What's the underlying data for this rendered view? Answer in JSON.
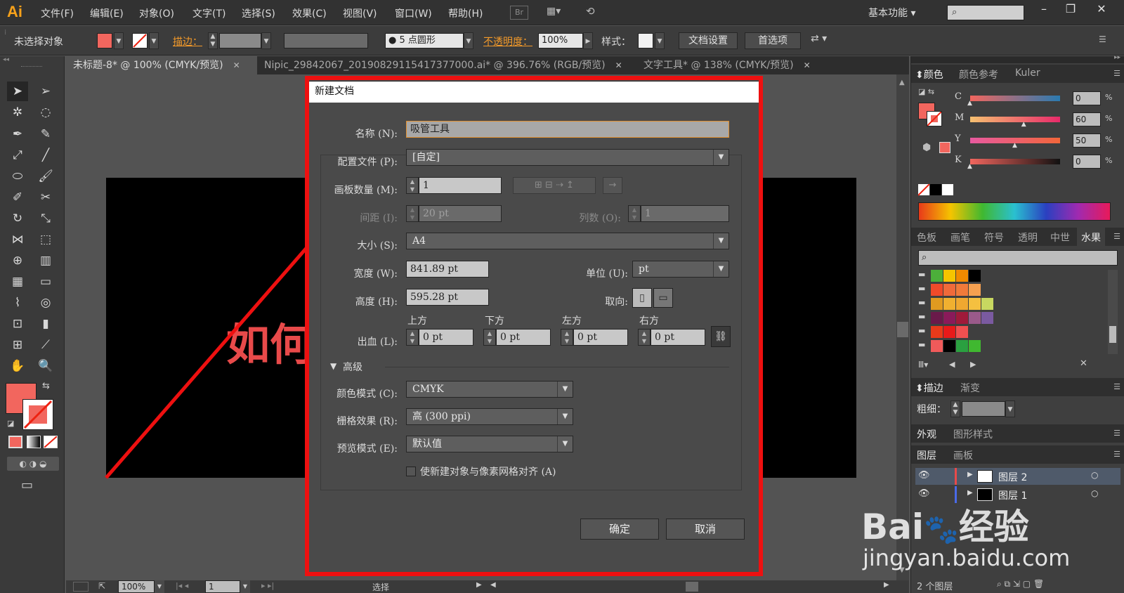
{
  "app": {
    "logo": "Ai",
    "menu": [
      "文件(F)",
      "编辑(E)",
      "对象(O)",
      "文字(T)",
      "选择(S)",
      "效果(C)",
      "视图(V)",
      "窗口(W)",
      "帮助(H)"
    ],
    "bridge_label": "Br",
    "workspace": "基本功能",
    "search_icon": "search-icon"
  },
  "control_bar": {
    "no_selection": "未选择对象",
    "stroke_label": "描边：",
    "brush_label": "5 点圆形",
    "opacity_label": "不透明度：",
    "opacity_value": "100%",
    "style_label": "样式：",
    "doc_setup": "文档设置",
    "preferences": "首选项",
    "fill_color": "#f2665e"
  },
  "tabs": [
    {
      "label": "未标题-8* @ 100% (CMYK/预览)",
      "active": true
    },
    {
      "label": "Nipic_29842067_20190829115417377000.ai* @ 396.76% (RGB/预览)",
      "active": false
    },
    {
      "label": "文字工具* @ 138% (CMYK/预览)",
      "active": false
    }
  ],
  "canvas": {
    "art_text": "如何"
  },
  "dialog": {
    "title": "新建文档",
    "name_label": "名称 (N):",
    "name_value": "吸管工具",
    "profile_label": "配置文件 (P):",
    "profile_value": "[自定]",
    "artboards_label": "画板数量 (M):",
    "artboards_value": "1",
    "spacing_label": "间距 (I):",
    "spacing_value": "20 pt",
    "columns_label": "列数 (O):",
    "columns_value": "1",
    "size_label": "大小 (S):",
    "size_value": "A4",
    "width_label": "宽度 (W):",
    "width_value": "841.89 pt",
    "units_label": "单位 (U):",
    "units_value": "pt",
    "height_label": "高度 (H):",
    "height_value": "595.28 pt",
    "orientation_label": "取向:",
    "bleed_label": "出血 (L):",
    "bleed_top_label": "上方",
    "bleed_top": "0 pt",
    "bleed_bottom_label": "下方",
    "bleed_bottom": "0 pt",
    "bleed_left_label": "左方",
    "bleed_left": "0 pt",
    "bleed_right_label": "右方",
    "bleed_right": "0 pt",
    "advanced_label": "高级",
    "color_mode_label": "颜色模式 (C):",
    "color_mode_value": "CMYK",
    "raster_label": "栅格效果 (R):",
    "raster_value": "高 (300 ppi)",
    "preview_label": "预览模式 (E):",
    "preview_value": "默认值",
    "align_pixel_label": "使新建对象与像素网格对齐 (A)",
    "ok": "确定",
    "cancel": "取消"
  },
  "color_panel": {
    "tabs": [
      "颜色",
      "颜色参考",
      "Kuler"
    ],
    "channels": [
      {
        "name": "C",
        "value": "0",
        "fraction": 0.0
      },
      {
        "name": "M",
        "value": "60",
        "fraction": 0.6
      },
      {
        "name": "Y",
        "value": "50",
        "fraction": 0.5
      },
      {
        "name": "K",
        "value": "0",
        "fraction": 0.0
      }
    ],
    "percent": "%"
  },
  "swatch_panel": {
    "tabs": [
      "色板",
      "画笔",
      "符号",
      "透明",
      "中世",
      "水果"
    ],
    "rows": [
      [
        "#4caf3a",
        "#f5c400",
        "#f08a00",
        "#000000"
      ],
      [
        "#f04a2a",
        "#f06a3a",
        "#f07a3a",
        "#f5a050"
      ],
      [
        "#e09a20",
        "#f0b030",
        "#f0a830",
        "#f5c040",
        "#c8d860"
      ],
      [
        "#6a1a4a",
        "#8a1a5a",
        "#a01a3a",
        "#9a5a8a",
        "#7a5aa0"
      ],
      [
        "#e83a1a",
        "#e81a1a",
        "#f05050"
      ],
      [
        "#f05a5a",
        "#000000",
        "#2aa040",
        "#40b830"
      ]
    ]
  },
  "stroke_panel": {
    "tabs": [
      "描边",
      "渐变"
    ],
    "weight_label": "粗细："
  },
  "appearance_panel": {
    "tabs": [
      "外观",
      "图形样式"
    ]
  },
  "layers_panel": {
    "tabs": [
      "图层",
      "画板"
    ],
    "layers": [
      "图层 2",
      "图层 1"
    ],
    "count": "2 个图层"
  },
  "status": {
    "zoom": "100%",
    "page": "1",
    "tool": "选择"
  },
  "watermark": {
    "brand": "Bai",
    "brand2": "经验",
    "url": "jingyan.baidu.com"
  }
}
